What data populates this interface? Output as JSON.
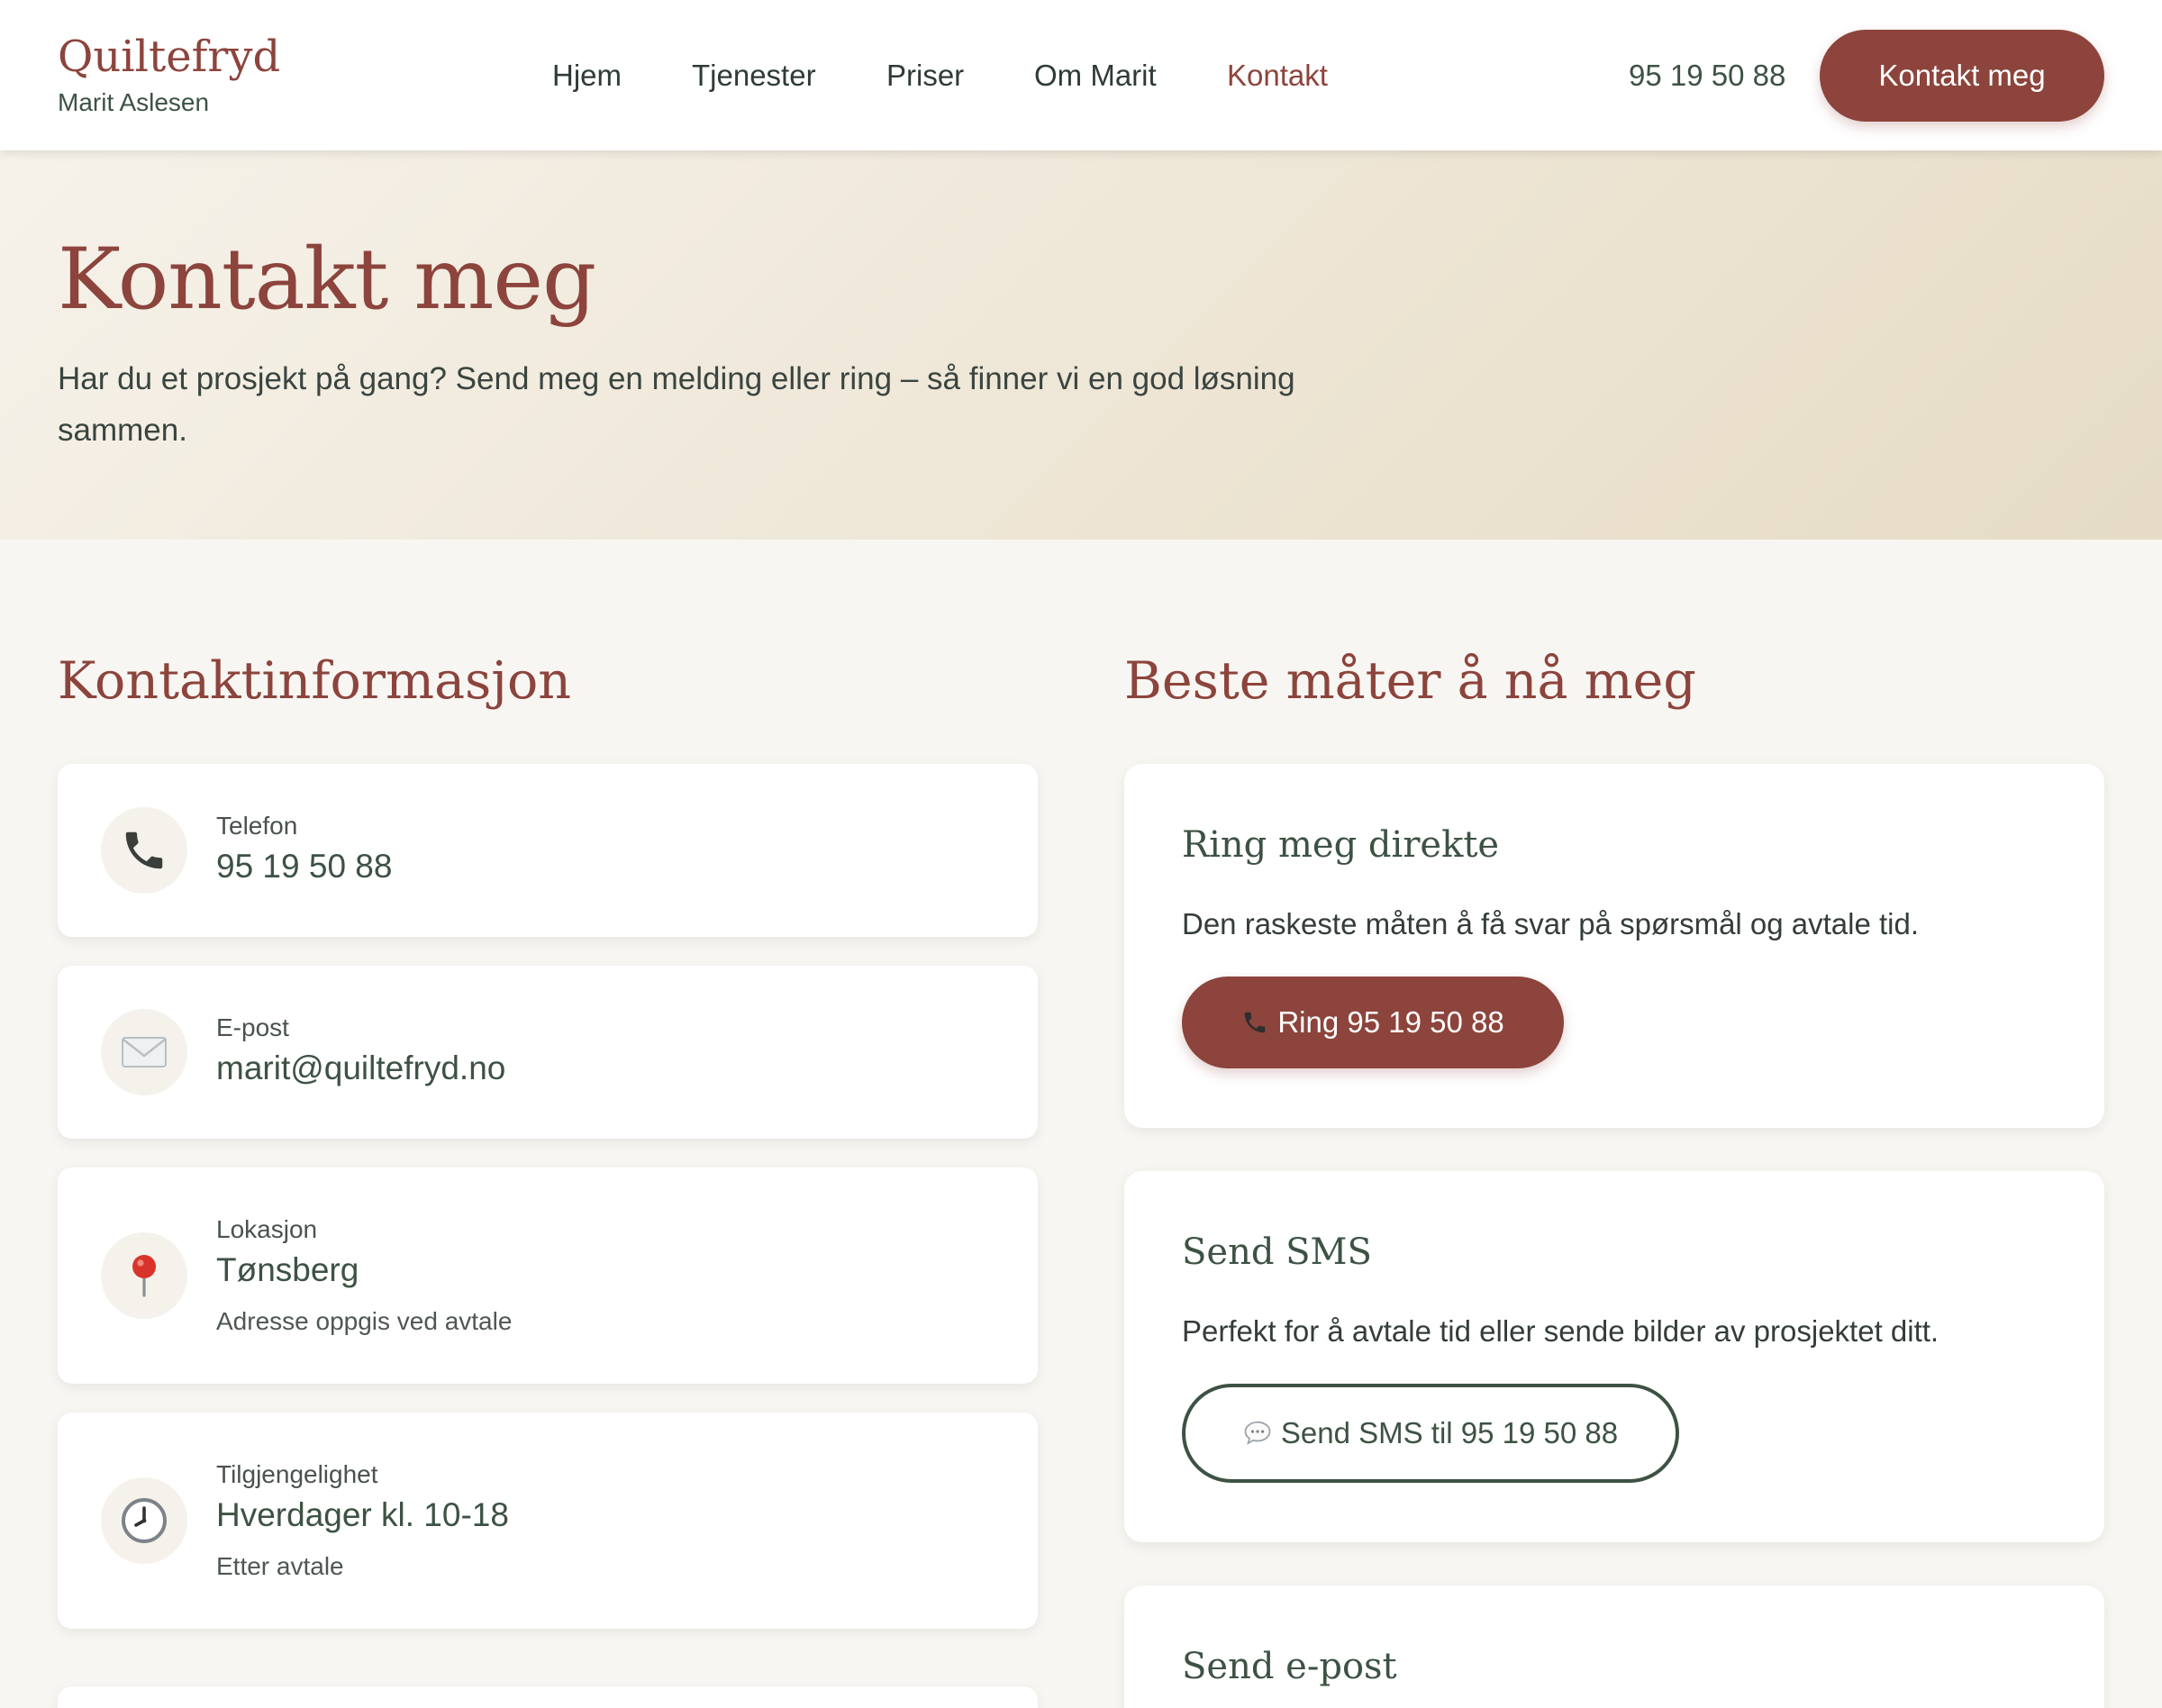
{
  "header": {
    "brand_name": "Quiltefryd",
    "brand_sub": "Marit Aslesen",
    "nav": [
      {
        "label": "Hjem",
        "active": false
      },
      {
        "label": "Tjenester",
        "active": false
      },
      {
        "label": "Priser",
        "active": false
      },
      {
        "label": "Om Marit",
        "active": false
      },
      {
        "label": "Kontakt",
        "active": true
      }
    ],
    "phone": "95 19 50 88",
    "cta_label": "Kontakt meg"
  },
  "hero": {
    "title": "Kontakt meg",
    "lead": "Har du et prosjekt på gang? Send meg en melding eller ring – så finner vi en god løsning sammen."
  },
  "contact_info": {
    "title": "Kontaktinformasjon",
    "items": [
      {
        "icon": "phone-icon",
        "label": "Telefon",
        "value": "95 19 50 88"
      },
      {
        "icon": "envelope-icon",
        "label": "E-post",
        "value": "marit@quiltefryd.no"
      },
      {
        "icon": "pin-icon",
        "label": "Lokasjon",
        "value": "Tønsberg",
        "note": "Adresse oppgis ved avtale"
      },
      {
        "icon": "clock-icon",
        "label": "Tilgjengelighet",
        "value": "Hverdager kl. 10-18",
        "note": "Etter avtale"
      }
    ]
  },
  "ways": {
    "title": "Beste måter å nå meg",
    "call": {
      "title": "Ring meg direkte",
      "desc": "Den raskeste måten å få svar på spørsmål og avtale tid.",
      "button": "Ring 95 19 50 88"
    },
    "sms": {
      "title": "Send SMS",
      "desc": "Perfekt for å avtale tid eller sende bilder av prosjektet ditt.",
      "button": "Send SMS til 95 19 50 88"
    },
    "email": {
      "title": "Send e-post"
    }
  },
  "colors": {
    "brand": "#8c443c",
    "green": "#3d5244",
    "page_bg": "#f8f6f2"
  }
}
